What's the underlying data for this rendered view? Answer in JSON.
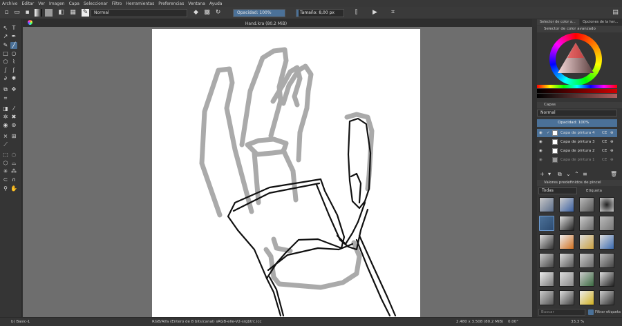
{
  "menu": [
    "Archivo",
    "Editar",
    "Ver",
    "Imagen",
    "Capa",
    "Seleccionar",
    "Filtro",
    "Herramientas",
    "Preferencias",
    "Ventana",
    "Ayuda"
  ],
  "toolbar": {
    "blend_mode": "Normal",
    "opacity_label": "Opacidad: 100%",
    "opacity_value": 1.0,
    "size_label": "Tamaño: 8,00 px",
    "size_value": 0.05
  },
  "document": {
    "title": "Hand.kra (80.2 MiB)"
  },
  "dock": {
    "tabs": [
      "Selector de color a...",
      "Opciones de la her..."
    ],
    "color_title": "Selector de color avanzado",
    "layers_title": "Capas",
    "layers_mode": "Normal",
    "layers_opacity": "Opacidad:  100%",
    "layers": [
      {
        "name": "Capa de pintura 4",
        "tag": "CE",
        "selected": true
      },
      {
        "name": "Capa de pintura 3",
        "tag": "CE",
        "selected": false
      },
      {
        "name": "Capa de pintura 2",
        "tag": "CE",
        "selected": false
      },
      {
        "name": "Capa de pintura 1",
        "tag": "CE",
        "selected": false
      }
    ],
    "brushes_title": "Valores predefinidos de pincel",
    "brush_filter": "Todas",
    "brush_tag_label": "Etiqueta",
    "search_placeholder": "Buscar",
    "filter_tag_label": "Filtrar etiqueta"
  },
  "status": {
    "brush": "b) Basic-1",
    "color_info": "RGB/Alfa (Entero de 8 bits/canal)  sRGB-elle-V2-srgbtrc.icc",
    "dimensions": "2.480 x 3.508 (80.2 MiB)",
    "rotation": "0.00°",
    "zoom": "33,3 %"
  },
  "colors": {
    "accent": "#4b7198",
    "background": "#313131",
    "canvas": "#6e6e6e"
  }
}
